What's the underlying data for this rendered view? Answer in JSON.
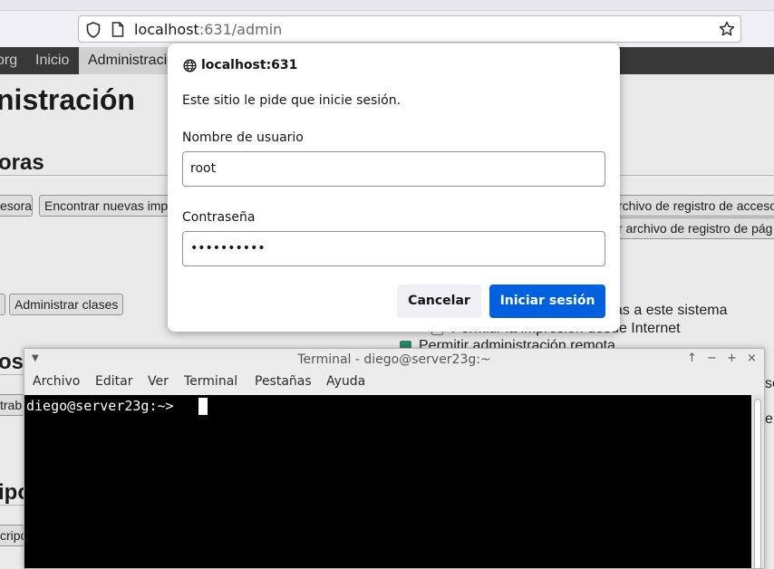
{
  "browser": {
    "url_host": "localhost",
    "url_path": ":631/admin"
  },
  "cups": {
    "nav": [
      "org",
      "Inicio",
      "Administració"
    ],
    "title": "nistración",
    "section_printers": "oras",
    "section_jobs": "os",
    "section_subscriptions": "ipo",
    "buttons": {
      "add_printer": "esora",
      "find_printers": "Encontrar nuevas imp",
      "manage_printers_partial": "",
      "manage_classes": "Administrar clases",
      "manage_jobs": "trab",
      "subscriptions": "cripc",
      "view_access_log": "rchivo de registro de acceso",
      "view_page_log": "r archivo de registro de pág"
    },
    "server_settings": {
      "share_text": "as a este sistema",
      "allow_internet": "Permitir la impresión desde Internet",
      "allow_remote_admin": "Permitir administración remota",
      "cut_right_1": "so",
      "cut_right_2": "e p"
    }
  },
  "auth_dialog": {
    "origin": "localhost:631",
    "message": "Este sitio le pide que inicie sesión.",
    "username_label": "Nombre de usuario",
    "username_value": "root",
    "password_label": "Contraseña",
    "password_value": "••••••••••",
    "cancel_label": "Cancelar",
    "login_label": "Iniciar sesión"
  },
  "terminal": {
    "title": "Terminal - diego@server23g:~",
    "menu": [
      "Archivo",
      "Editar",
      "Ver",
      "Terminal",
      "Pestañas",
      "Ayuda"
    ],
    "prompt": "diego@server23g:~> "
  },
  "colors": {
    "accent": "#0061e0",
    "terminal_bg": "#000000",
    "navbar_bg": "#3b3b3b"
  }
}
